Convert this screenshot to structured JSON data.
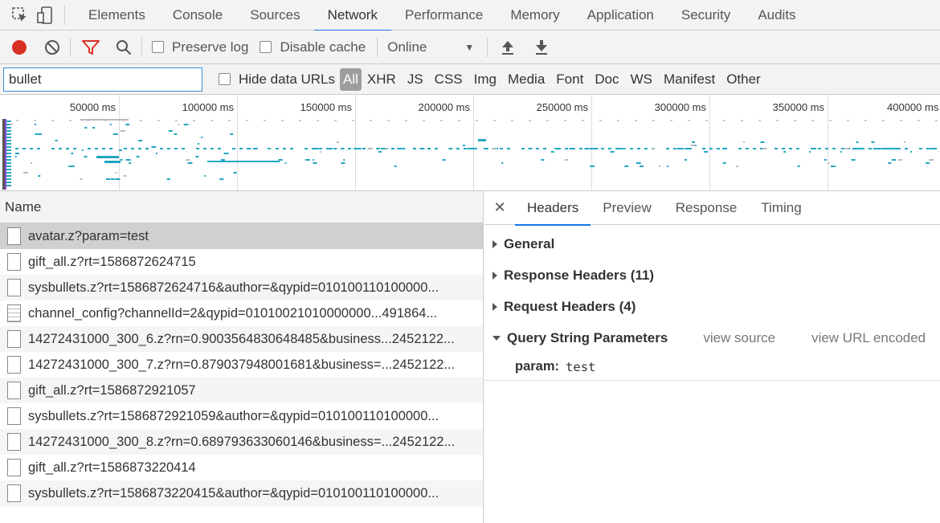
{
  "devtools": {
    "tabs": [
      "Elements",
      "Console",
      "Sources",
      "Network",
      "Performance",
      "Memory",
      "Application",
      "Security",
      "Audits"
    ],
    "active_tab": "Network"
  },
  "toolbar": {
    "preserve_log": "Preserve log",
    "disable_cache": "Disable cache",
    "throttle": "Online"
  },
  "filter": {
    "value": "bullet",
    "hide_data_urls": "Hide data URLs",
    "types": [
      "All",
      "XHR",
      "JS",
      "CSS",
      "Img",
      "Media",
      "Font",
      "Doc",
      "WS",
      "Manifest",
      "Other"
    ],
    "active_type": "All"
  },
  "overview": {
    "ticks": [
      "50000 ms",
      "100000 ms",
      "150000 ms",
      "200000 ms",
      "250000 ms",
      "300000 ms",
      "350000 ms",
      "400000 ms"
    ],
    "bar_color": "#21a6c4"
  },
  "requests": {
    "header": "Name",
    "rows": [
      {
        "name": "avatar.z?param=test",
        "selected": true
      },
      {
        "name": "gift_all.z?rt=1586872624715"
      },
      {
        "name": "sysbullets.z?rt=1586872624716&author=&qypid=010100110100000..."
      },
      {
        "name": "channel_config?channelId=2&qypid=01010021010000000...491864...",
        "doc": true
      },
      {
        "name": "14272431000_300_6.z?rn=0.9003564830648485&business...2452122..."
      },
      {
        "name": "14272431000_300_7.z?rn=0.879037948001681&business=...2452122..."
      },
      {
        "name": "gift_all.z?rt=1586872921057"
      },
      {
        "name": "sysbullets.z?rt=1586872921059&author=&qypid=010100110100000..."
      },
      {
        "name": "14272431000_300_8.z?rn=0.689793633060146&business=...2452122..."
      },
      {
        "name": "gift_all.z?rt=1586873220414"
      },
      {
        "name": "sysbullets.z?rt=1586873220415&author=&qypid=010100110100000..."
      }
    ]
  },
  "details": {
    "tabs": [
      "Headers",
      "Preview",
      "Response",
      "Timing"
    ],
    "active_tab": "Headers",
    "general": "General",
    "response_headers": "Response Headers (11)",
    "request_headers": "Request Headers (4)",
    "query_string": "Query String Parameters",
    "view_source": "view source",
    "view_url_encoded": "view URL encoded",
    "param_key": "param:",
    "param_value": "test"
  }
}
